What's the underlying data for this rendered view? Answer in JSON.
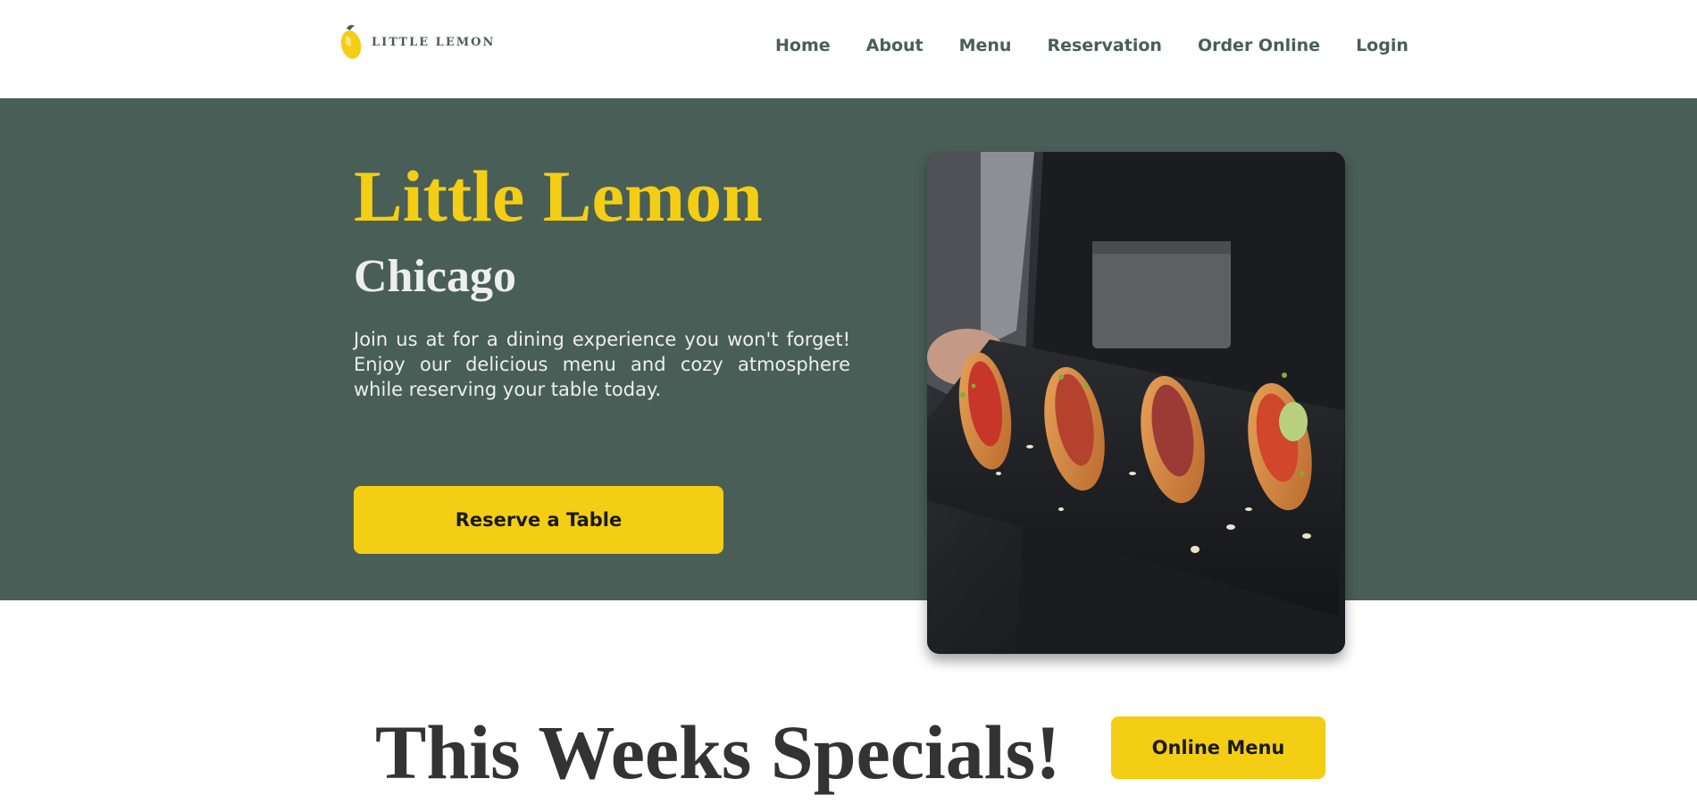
{
  "header": {
    "logo_text": "LITTLE LEMON",
    "logo_icon": "lemon-logo-icon",
    "nav": [
      {
        "label": "Home"
      },
      {
        "label": "About"
      },
      {
        "label": "Menu"
      },
      {
        "label": "Reservation"
      },
      {
        "label": "Order Online"
      },
      {
        "label": "Login"
      }
    ]
  },
  "hero": {
    "title": "Little Lemon",
    "city": "Chicago",
    "description": "Join us at for a dining experience you won't forget! Enjoy our delicious menu and cozy atmosphere while reserving your table today.",
    "cta_label": "Reserve a Table",
    "image": "food-platter-image"
  },
  "specials": {
    "title": "This Weeks Specials!",
    "button_label": "Online Menu"
  },
  "colors": {
    "primary_green": "#495e57",
    "primary_yellow": "#f4ce14",
    "text_dark": "#333333",
    "text_light": "#edefee"
  }
}
